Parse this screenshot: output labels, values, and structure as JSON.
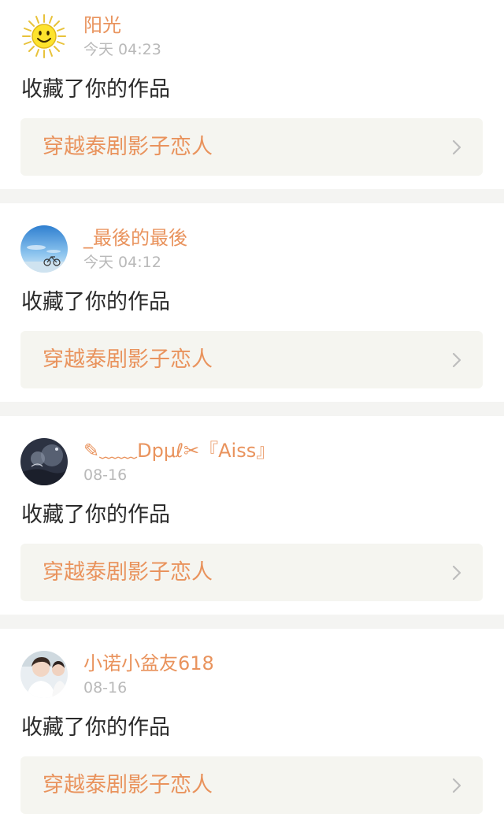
{
  "notifications": [
    {
      "username": "阳光",
      "timestamp": "今天 04:23",
      "action": "收藏了你的作品",
      "work_title": "穿越泰剧影子恋人",
      "avatar_icon": "sun-avatar-icon"
    },
    {
      "username": "_最後的最後",
      "timestamp": "今天 04:12",
      "action": "收藏了你的作品",
      "work_title": "穿越泰剧影子恋人",
      "avatar_icon": "sky-bicycle-avatar-icon"
    },
    {
      "username": "✎﹏﹏Dpμℓ✂『Aiss』",
      "timestamp": "08-16",
      "action": "收藏了你的作品",
      "work_title": "穿越泰剧影子恋人",
      "avatar_icon": "dark-scene-avatar-icon"
    },
    {
      "username": "小诺小盆友618",
      "timestamp": "08-16",
      "action": "收藏了你的作品",
      "work_title": "穿越泰剧影子恋人",
      "avatar_icon": "person-photo-avatar-icon"
    }
  ],
  "colors": {
    "accent": "#e9935d",
    "timestamp": "#b9b9b9",
    "link_background": "#f5f5f0",
    "divider": "#f4f4f2"
  }
}
